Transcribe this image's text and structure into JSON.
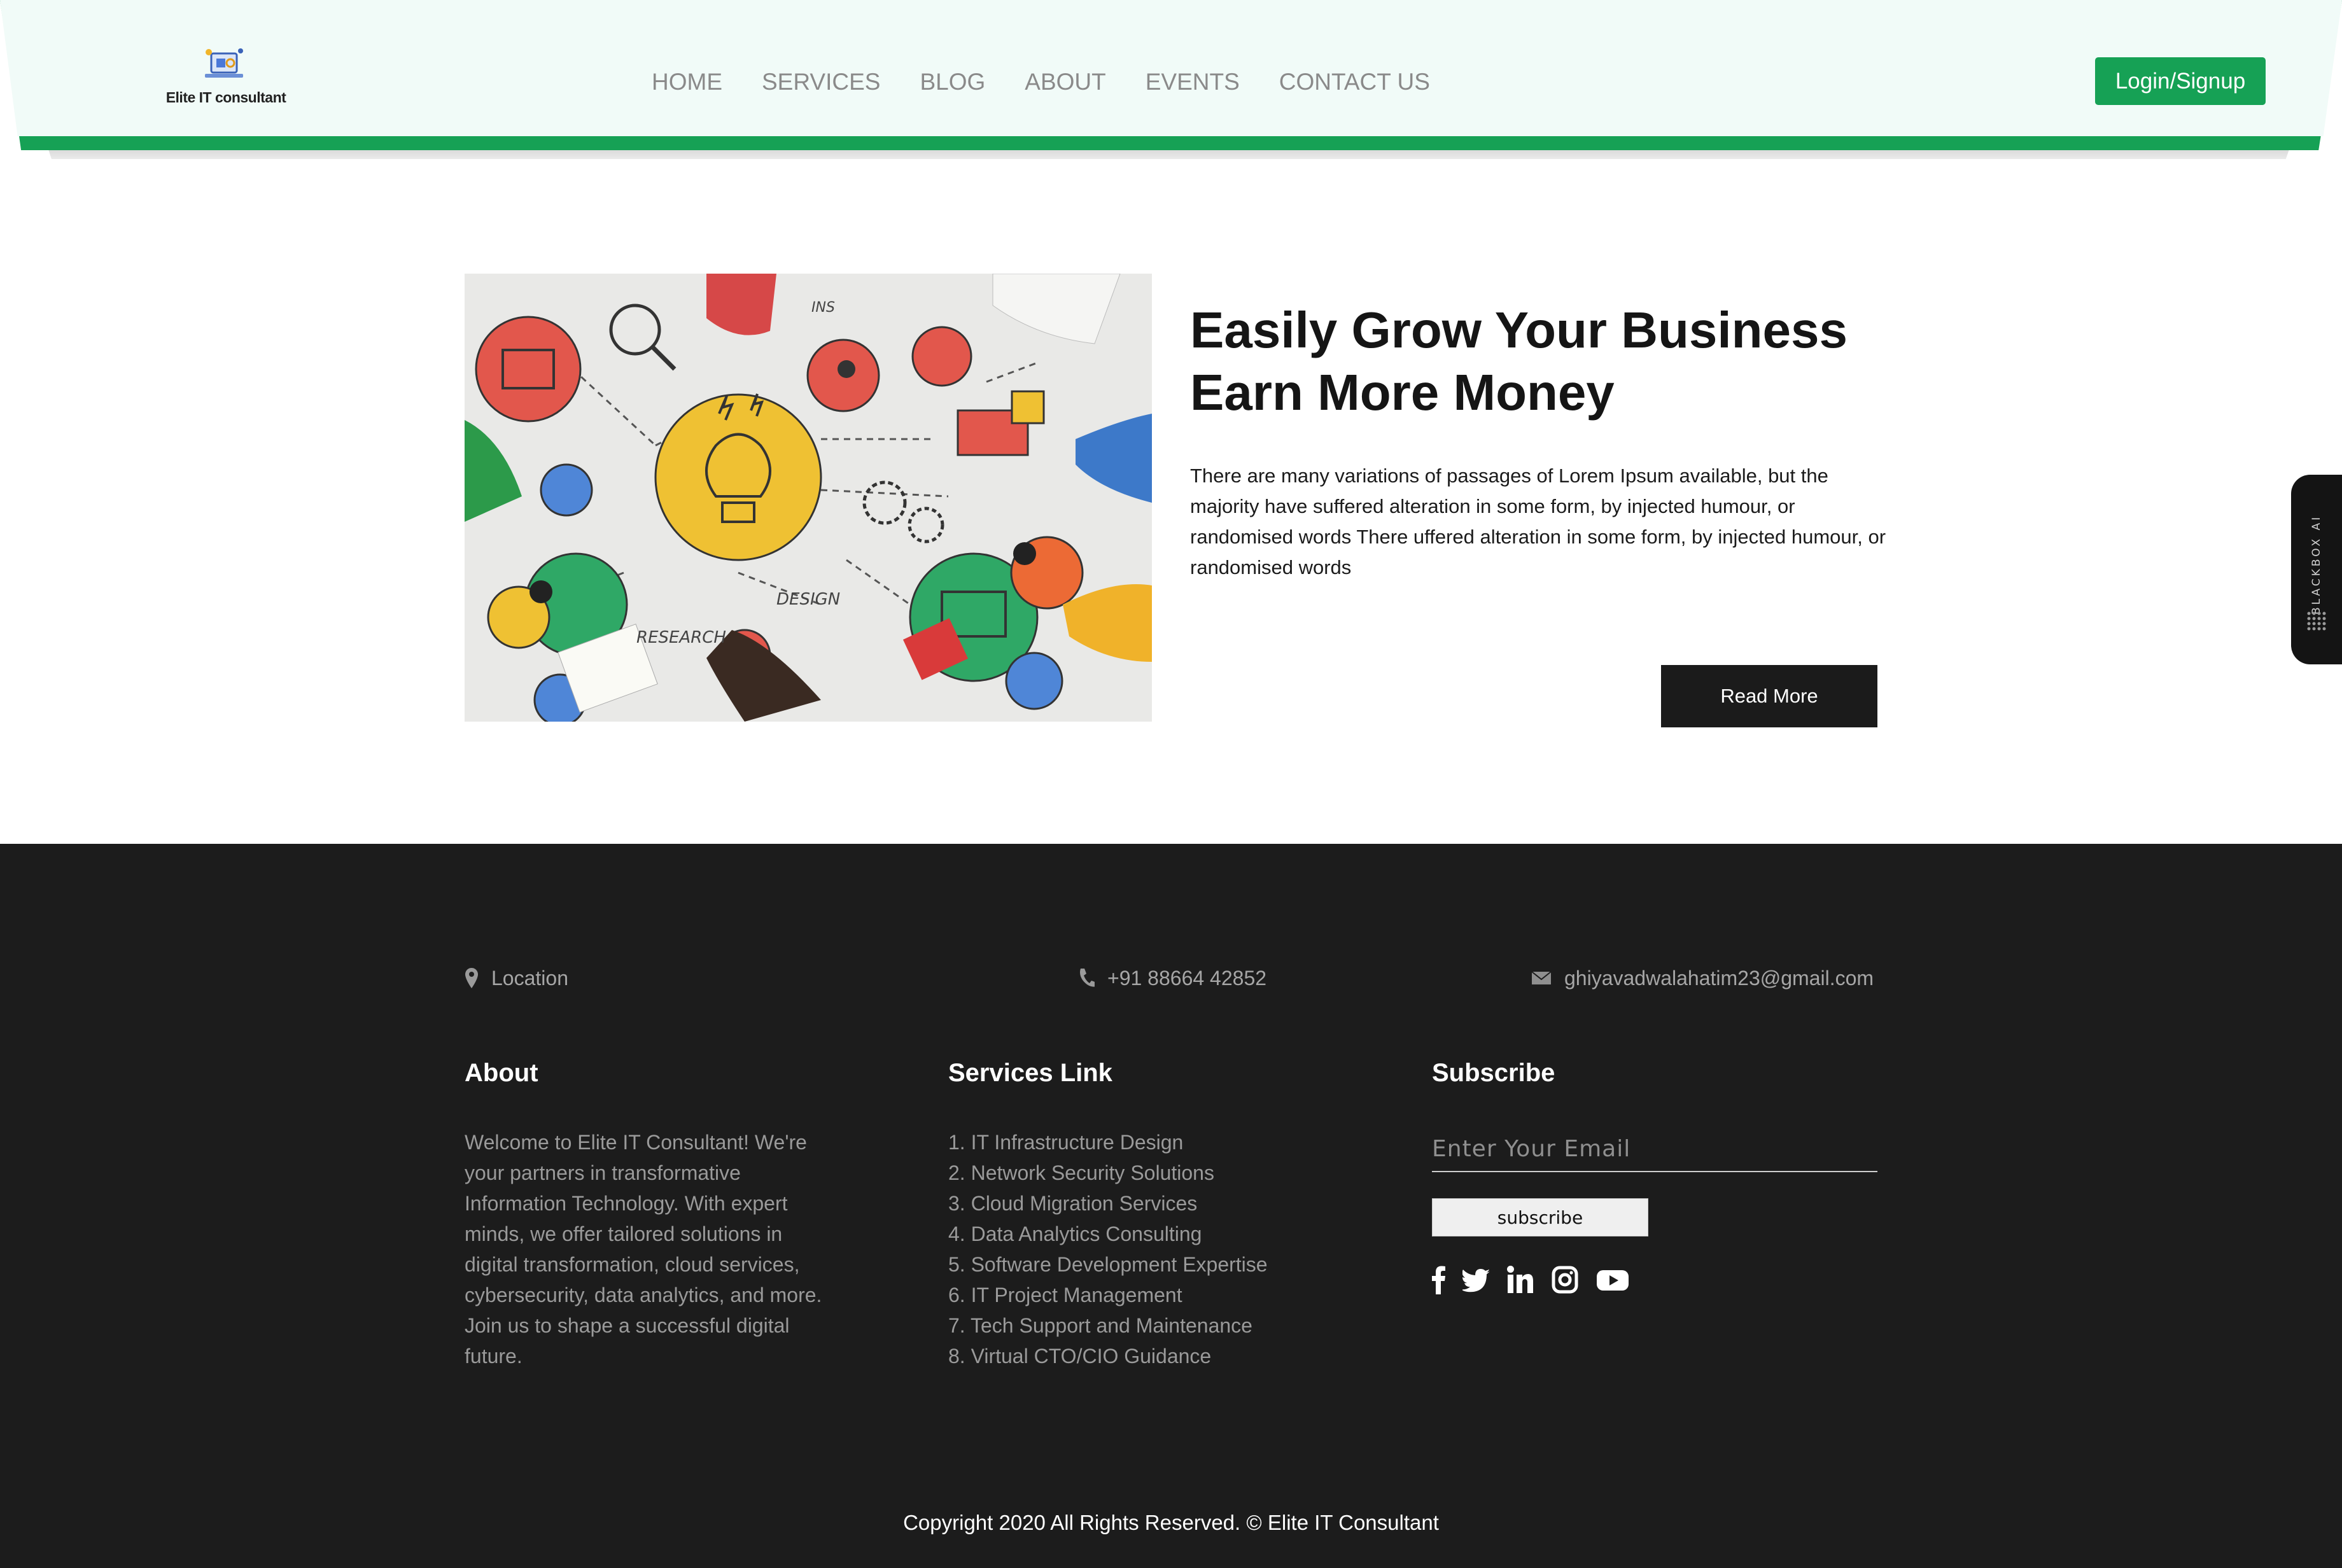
{
  "header": {
    "logo_text": "Elite IT consultant",
    "nav": [
      "HOME",
      "SERVICES",
      "BLOG",
      "ABOUT",
      "EVENTS",
      "CONTACT US"
    ],
    "login_label": "Login/Signup"
  },
  "hero": {
    "title_line1": "Easily Grow Your Business",
    "title_line2": "Earn More Money",
    "body": "There are many variations of passages of Lorem Ipsum available, but the majority have suffered alteration in some form, by injected humour, or randomised words There uffered alteration in some form, by injected humour, or randomised words",
    "read_more_label": "Read More",
    "image_words": [
      "DESIGN",
      "RESEARCH",
      "INS"
    ]
  },
  "side_widget": {
    "label": "BLACKBOX AI"
  },
  "footer": {
    "location_label": "Location",
    "phone": "+91 88664 42852",
    "email": "ghiyavadwalahatim23@gmail.com",
    "about_heading": "About",
    "about_text": "Welcome to Elite IT Consultant! We're your partners in transformative Information Technology. With expert minds, we offer tailored solutions in digital transformation, cloud services, cybersecurity, data analytics, and more. Join us to shape a successful digital future.",
    "services_heading": "Services Link",
    "services": [
      "1. IT Infrastructure Design",
      "2. Network Security Solutions",
      "3. Cloud Migration Services",
      "4. Data Analytics Consulting",
      "5. Software Development Expertise",
      "6. IT Project Management",
      "7. Tech Support and Maintenance",
      "8. Virtual CTO/CIO Guidance"
    ],
    "subscribe_heading": "Subscribe",
    "email_placeholder": "Enter Your Email",
    "subscribe_label": "subscribe",
    "social_icons": [
      "facebook-icon",
      "twitter-icon",
      "linkedin-icon",
      "instagram-icon",
      "youtube-icon"
    ],
    "copyright": "Copyright 2020 All Rights Reserved. © Elite IT Consultant"
  },
  "colors": {
    "brand_green": "#16a155",
    "header_bg": "#f1fbf8",
    "footer_bg": "#1c1c1c",
    "dark_button": "#1b1b1b"
  }
}
